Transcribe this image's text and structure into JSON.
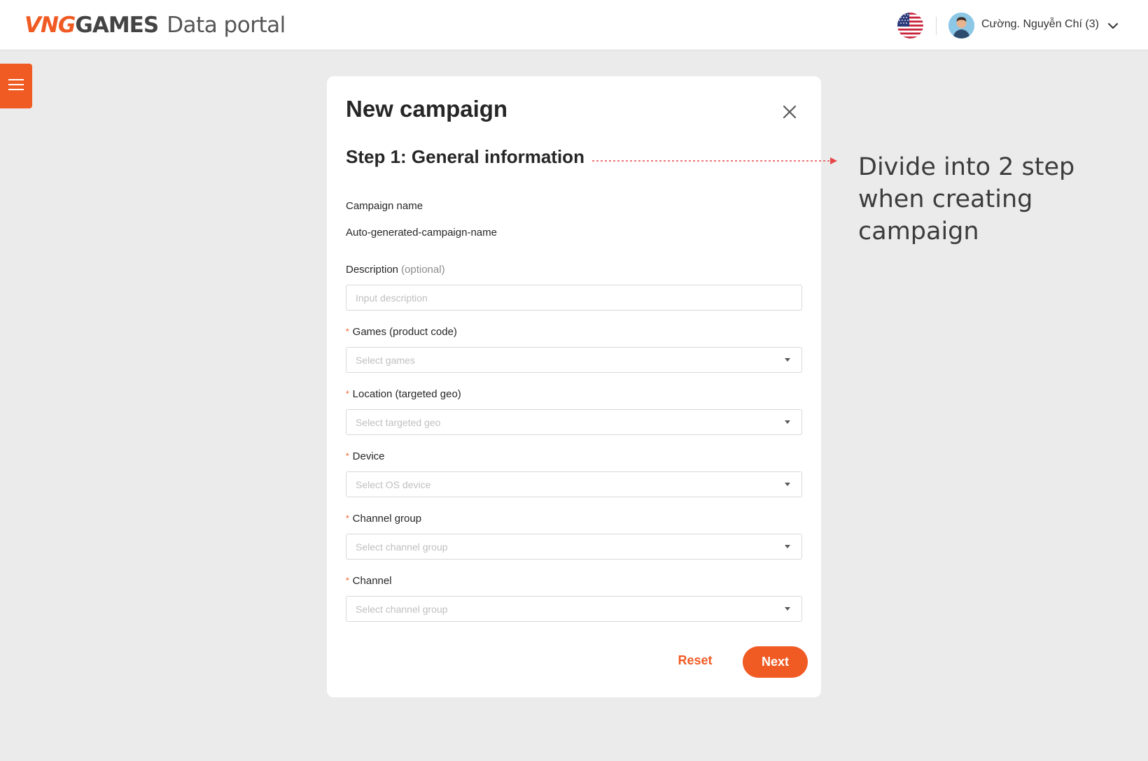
{
  "header": {
    "brand_logo": "VNGGAMES",
    "brand_logo_vng": "VNG",
    "brand_logo_games": "GAMES",
    "brand_title": "Data portal",
    "language_flag": "us-flag-icon",
    "user_name": "Cường. Nguyễn Chí (3)"
  },
  "sidebar": {
    "menu_icon": "hamburger-menu-icon"
  },
  "modal": {
    "title": "New campaign",
    "step_title": "Step 1: General information",
    "fields": {
      "campaign_name": {
        "label": "Campaign name",
        "value": "Auto-generated-campaign-name"
      },
      "description": {
        "label": "Description",
        "optional": "(optional)",
        "placeholder": "Input description"
      },
      "games": {
        "label": "Games (product code)",
        "placeholder": "Select games",
        "required": "*"
      },
      "location": {
        "label": "Location (targeted geo)",
        "placeholder": "Select targeted geo",
        "required": "*"
      },
      "device": {
        "label": "Device",
        "placeholder": "Select OS device",
        "required": "*"
      },
      "channel_group": {
        "label": "Channel group",
        "placeholder": "Select channel group",
        "required": "*"
      },
      "channel": {
        "label": "Channel",
        "placeholder": "Select channel group",
        "required": "*"
      }
    },
    "buttons": {
      "reset": "Reset",
      "next": "Next"
    }
  },
  "annotation": {
    "text": "Divide into 2 step when creating campaign"
  },
  "colors": {
    "accent": "#f05a23",
    "background": "#ebebeb",
    "modal_background": "#ffffff",
    "required_mark": "#f05a23",
    "annotation_line": "#e8474a"
  }
}
